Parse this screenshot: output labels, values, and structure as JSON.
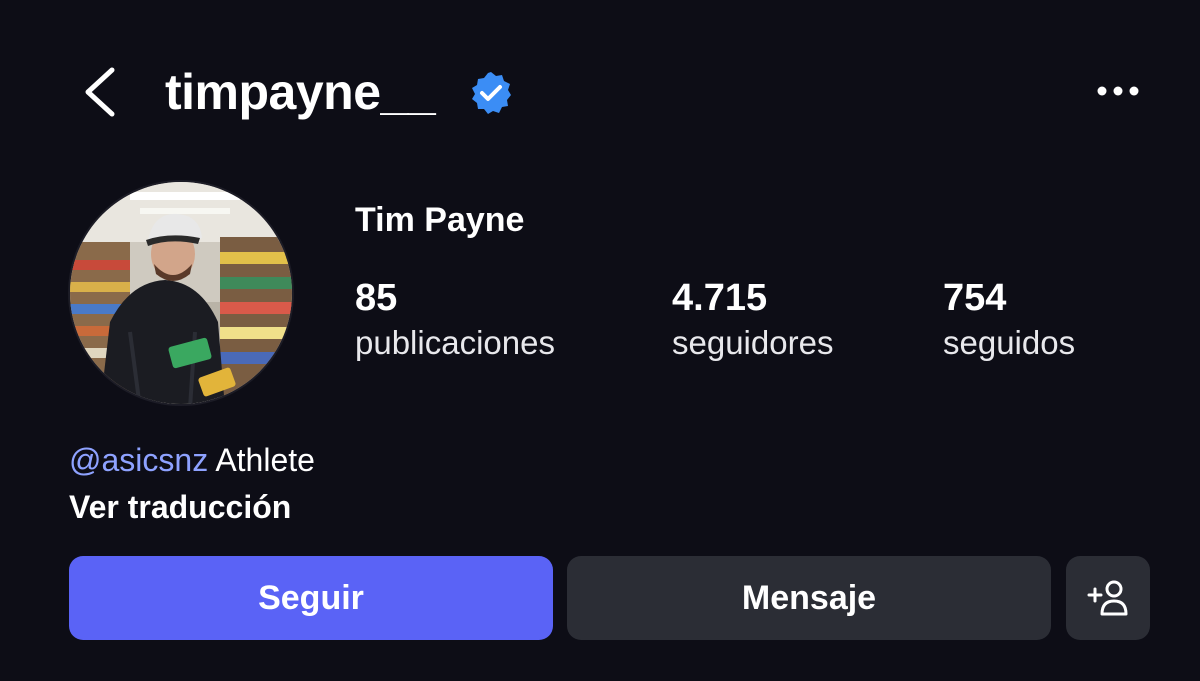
{
  "header": {
    "username": "timpayne__",
    "verified_icon": "verified-badge-icon",
    "back_icon": "chevron-left-icon",
    "more_icon": "more-horizontal-icon"
  },
  "profile": {
    "display_name": "Tim Payne",
    "stats": [
      {
        "count": "85",
        "label": "publicaciones"
      },
      {
        "count": "4.715",
        "label": "seguidores"
      },
      {
        "count": "754",
        "label": "seguidos"
      }
    ],
    "bio": {
      "mention": "@asicsnz",
      "text": " Athlete"
    },
    "translate_label": "Ver traducción"
  },
  "actions": {
    "follow_label": "Seguir",
    "message_label": "Mensaje",
    "suggest_icon": "add-person-icon"
  },
  "colors": {
    "background": "#0d0d16",
    "follow_button": "#5a63f6",
    "secondary_button": "#2b2d35",
    "verified": "#3b8df5",
    "mention": "#8ea2ff"
  }
}
